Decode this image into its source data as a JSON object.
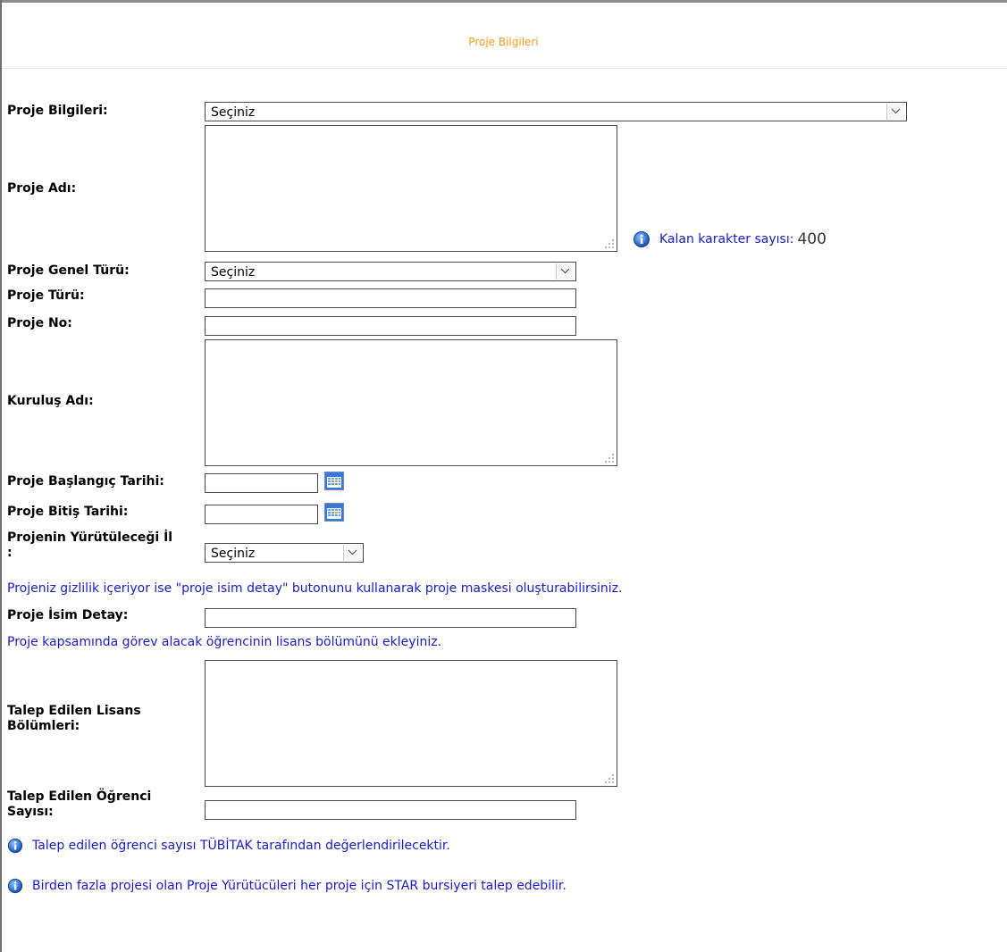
{
  "header": {
    "title": "Proje Bilgileri"
  },
  "fields": {
    "proje_bilgileri": {
      "label": "Proje Bilgileri:",
      "value": "Seçiniz"
    },
    "proje_adi": {
      "label": "Proje Adı:"
    },
    "counter": {
      "label": "Kalan karakter sayısı:",
      "value": "400"
    },
    "proje_genel_turu": {
      "label": "Proje Genel Türü:",
      "value": "Seçiniz"
    },
    "proje_turu": {
      "label": "Proje Türü:"
    },
    "proje_no": {
      "label": "Proje No:"
    },
    "kurulus_adi": {
      "label": "Kuruluş Adı:"
    },
    "baslangic_tarihi": {
      "label": "Proje Başlangıç Tarihi:"
    },
    "bitis_tarihi": {
      "label": "Proje Bitiş Tarihi:"
    },
    "il": {
      "label_line1": "Projenin Yürütüleceği İl",
      "label_line2": ":",
      "value": "Seçiniz"
    },
    "gizlilik_note": "Projeniz gizlilik içeriyor ise \"proje isim detay\" butonunu kullanarak proje maskesi oluşturabilirsiniz.",
    "isim_detay": {
      "label": "Proje İsim Detay:"
    },
    "lisans_note": "Proje kapsamında görev alacak öğrencinin lisans bölümünü ekleyiniz.",
    "lisans_bolumleri": {
      "label_line1": "Talep Edilen Lisans",
      "label_line2": "Bölümleri:"
    },
    "ogrenci_sayisi": {
      "label_line1": "Talep Edilen Öğrenci",
      "label_line2": "Sayısı:"
    }
  },
  "info_messages": [
    "Talep edilen öğrenci sayısı TÜBİTAK tarafından değerlendirilecektir.",
    "Birden fazla projesi olan Proje Yürütücüleri her proje için STAR bursiyeri talep edebilir."
  ],
  "icons": {
    "info": "info-icon",
    "calendar": "calendar-icon",
    "dropdown": "chevron-down-icon",
    "resize": "resize-grip-icon"
  }
}
